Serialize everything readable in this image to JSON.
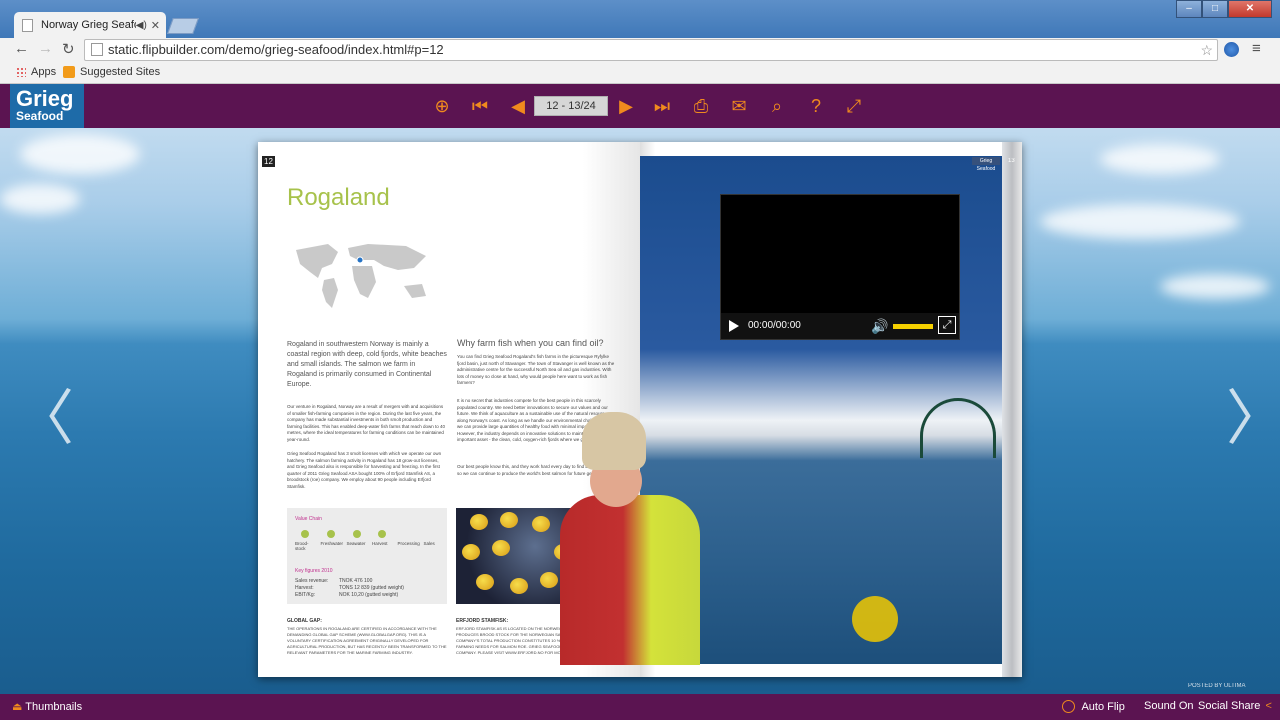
{
  "browser": {
    "tab_title": "Norway Grieg Seafood",
    "url": "static.flipbuilder.com/demo/grieg-seafood/index.html#p=12",
    "bookmarks": [
      "Apps",
      "Suggested Sites"
    ]
  },
  "app": {
    "logo_line1": "Grieg",
    "logo_line2": "Seafood",
    "page_indicator": "12 - 13/24",
    "thumbnails_label": "Thumbnails",
    "auto_flip_label": "Auto Flip",
    "sound_label": "Sound On",
    "social_share_label": "Social Share",
    "watermark": "POSTED BY ULTIMA"
  },
  "left_page": {
    "page_number": "12",
    "title": "Rogaland",
    "lead": "Rogaland in southwestern Norway is mainly a coastal region with deep, cold fjords, white beaches and small islands. The salmon we farm in Rogaland is primarily consumed in Continental Europe.",
    "para1": "Our venture in Rogaland, Norway are a result of mergers with and acquisitions of smaller fish-farming companies in the region. During the last five years, the company has made substantial investments in both smolt production and farming facilities. This has enabled deep-water fish farms that reach down to 40 metres, where the ideal temperatures for farming conditions can be maintained year-round.",
    "para2": "Grieg Seafood Rogaland has 3 smolt licenses with which we operate our own hatchery. The salmon farming activity in Rogaland has 18 grow-out licenses, and Grieg Seafood also is responsible for harvesting and freezing. In the first quarter of 2011 Grieg Seafood ASA bought 100% of Erfjord Stamfisk AS, a broodstock (roe) company. We employ about 90 people including Erfjord Stamfisk.",
    "subtitle": "Why farm fish when you can find oil?",
    "right_col1": "You can find Grieg Seafood Rogaland's fish farms in the picturesque Ryfylke fjord basin, just north of Stavanger. The town of Stavanger is well known as the administrative centre for the successful North Sea oil and gas industries. With lots of money so close at hand, why would people here want to work as fish farmers?",
    "right_col2": "It is no secret that industries compete for the best people in this scarcely populated country. We need better innovations to secure our values and our future. We think of aquaculture as a sustainable use of the natural resources along Norway's coast. As long as we handle our environmental challenges well, we can provide large quantities of healthy food with minimal impact on nature. However, the industry depends on innovative solutions to maintain our most important asset - the clean, cold, oxygen-rich fjords where we grow our fish.",
    "right_col3": "Our best people know this, and they work hard every day to find better solutions so we can continue to produce the world's best salmon for future generations.",
    "value_chain_title": "Value Chain",
    "value_chain": [
      "Brood-stock",
      "Freshwater",
      "Seawater",
      "Harvest",
      "Processing",
      "Sales"
    ],
    "key_figures_title": "Key figures 2010",
    "key_figures": [
      {
        "label": "Sales revenue:",
        "value": "TNOK 476 100"
      },
      {
        "label": "Harvest:",
        "value": "TONS 12 839 (gutted weight)"
      },
      {
        "label": "EBIT/Kg:",
        "value": "NOK 10,20 (gutted weight)"
      }
    ],
    "gap_title": "GLOBAL GAP:",
    "gap_text": "THE OPERATIONS IN ROGALAND ARE CERTIFIED IN ACCORDANCE WITH THE DEMANDING GLOBAL GAP SCHEME (WWW.GLOBALGAP.ORG). THIS IS A VOLUNTARY CERTIFICATION AGREEMENT ORIGINALLY DEVELOPED FOR AGRICULTURAL PRODUCTION, BUT HAS RECENTLY BEEN TRANSFORMED TO THE RELEVANT PARAMETERS FOR THE MARINE FARMING INDUSTRY.",
    "erfjord_title": "ERFJORD STAMFISK:",
    "erfjord_text": "ERFJORD STAMFISK AS IS LOCATED ON THE NORWEGIAN SOUTH WEST COAST. PRODUCES BROOD STOCK FOR THE NORWEGIAN SALMON INDUSTRY. THE COMPANY'S TOTAL PRODUCTION CONSTITUTES 10 % OF NORWEGIAN FISH FARMING NEEDS FOR SALMON ROE. GRIEG SEAFOOD NOW OWNS 100% OF THE COMPANY. PLEASE VISIT WWW.ERFJORD.NO FOR MORE INFORMATION."
  },
  "right_page": {
    "brand_tag": "Grieg Seafood",
    "page_number": "13",
    "video_time": "00:00/00:00"
  }
}
